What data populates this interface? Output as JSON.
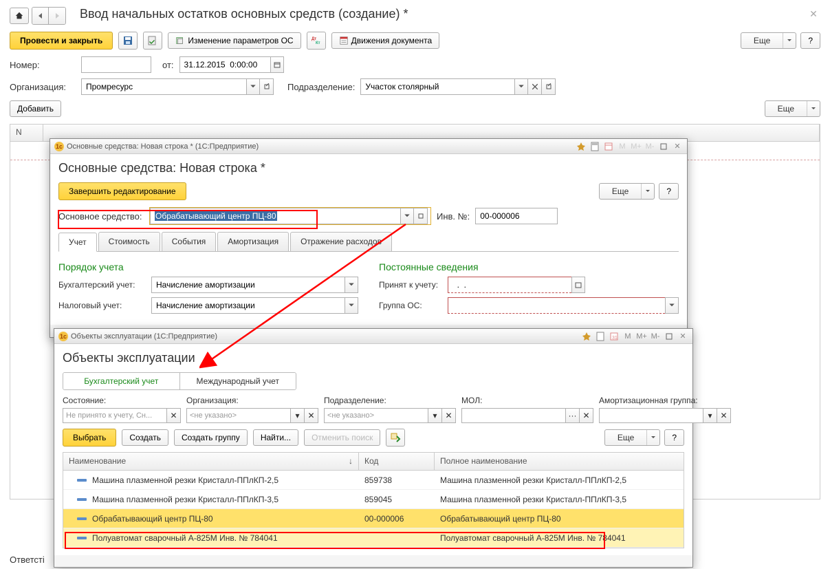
{
  "main": {
    "title": "Ввод начальных остатков основных средств (создание) *",
    "toolbar": {
      "save_close": "Провести и закрыть",
      "change_params": "Изменение параметров ОС",
      "movements": "Движения документа",
      "more": "Еще",
      "help": "?"
    },
    "form": {
      "number_label": "Номер:",
      "from_label": "от:",
      "date_value": "31.12.2015  0:00:00",
      "org_label": "Организация:",
      "org_value": "Промресурс",
      "dept_label": "Подразделение:",
      "dept_value": "Участок столярный",
      "add": "Добавить",
      "more": "Еще"
    },
    "grid": {
      "col_n": "N"
    },
    "bottom": {
      "responsible": "Ответсті"
    }
  },
  "dialog1": {
    "titlebar": "Основные средства: Новая строка *  (1С:Предприятие)",
    "heading": "Основные средства: Новая строка *",
    "finish_edit": "Завершить редактирование",
    "more": "Еще",
    "help": "?",
    "os_label": "Основное средство:",
    "os_value": "Обрабатывающий центр ПЦ-80",
    "inv_label": "Инв. №:",
    "inv_value": "00-000006",
    "tabs": [
      "Учет",
      "Стоимость",
      "События",
      "Амортизация",
      "Отражение расходов"
    ],
    "section1": "Порядок учета",
    "section2": "Постоянные сведения",
    "row_buh": "Бухгалтерский учет:",
    "row_buh_val": "Начисление амортизации",
    "row_tax": "Налоговый учет:",
    "row_tax_val": "Начисление амортизации",
    "row_accepted": "Принят к учету:",
    "row_accepted_val": "  .  .    ",
    "row_group": "Группа ОС:"
  },
  "dialog2": {
    "titlebar": "Объекты эксплуатации  (1С:Предприятие)",
    "heading": "Объекты эксплуатации",
    "tab_buh": "Бухгалтерский учет",
    "tab_int": "Международный учет",
    "filters": {
      "state": "Состояние:",
      "state_ph": "Не принято к учету, Сн...",
      "org": "Организация:",
      "org_ph": "<не указано>",
      "dept": "Подразделение:",
      "dept_ph": "<не указано>",
      "mol": "МОЛ:",
      "amort": "Амортизационная группа:"
    },
    "toolbar": {
      "select": "Выбрать",
      "create": "Создать",
      "create_group": "Создать группу",
      "find": "Найти...",
      "cancel_search": "Отменить поиск",
      "more": "Еще",
      "help": "?"
    },
    "list": {
      "col_name": "Наименование",
      "col_code": "Код",
      "col_full": "Полное наименование",
      "rows": [
        {
          "name": "Машина плазменной резки Кристалл-ППлКП-2,5",
          "code": "859738",
          "full": "Машина плазменной резки Кристалл-ППлКП-2,5"
        },
        {
          "name": "Машина плазменной резки Кристалл-ППлКП-3,5",
          "code": "859045",
          "full": "Машина плазменной резки Кристалл-ППлКП-3,5"
        },
        {
          "name": "Обрабатывающий центр ПЦ-80",
          "code": "00-000006",
          "full": "Обрабатывающий центр ПЦ-80"
        },
        {
          "name": "Полуавтомат сварочный А-825М    Инв. № 784041",
          "code": "",
          "full": "Полуавтомат сварочный А-825М    Инв. № 784041"
        }
      ]
    },
    "m_buttons": [
      "M",
      "M+",
      "M-"
    ]
  }
}
